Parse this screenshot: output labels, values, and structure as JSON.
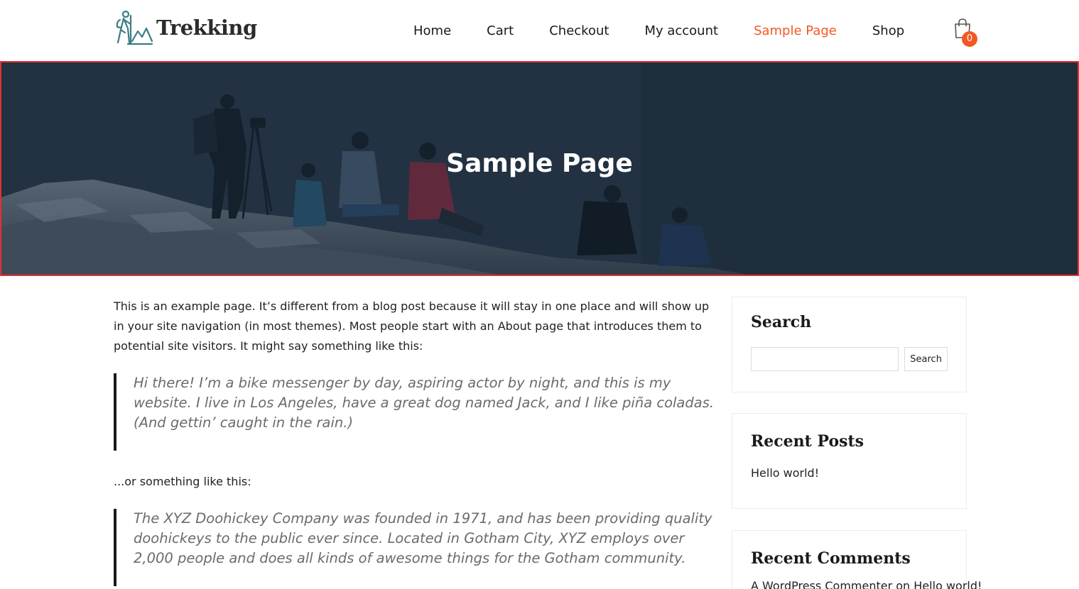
{
  "brand": {
    "name": "Trekking",
    "accent": "#f25822"
  },
  "nav": {
    "items": [
      {
        "label": "Home"
      },
      {
        "label": "Cart"
      },
      {
        "label": "Checkout"
      },
      {
        "label": "My account"
      },
      {
        "label": "Sample Page",
        "active": true
      },
      {
        "label": "Shop"
      }
    ]
  },
  "cart": {
    "icon": "shopping-bag-icon",
    "count": "0"
  },
  "hero": {
    "title": "Sample Page"
  },
  "content": {
    "intro": "This is an example page. It’s different from a blog post because it will stay in one place and will show up in your site navigation (in most themes). Most people start with an About page that introduces them to potential site visitors. It might say something like this:",
    "quote1": "Hi there! I’m a bike messenger by day, aspiring actor by night, and this is my website. I live in Los Angeles, have a great dog named Jack, and I like piña coladas. (And gettin’ caught in the rain.)",
    "transition": "...or something like this:",
    "quote2": "The XYZ Doohickey Company was founded in 1971, and has been providing quality doohickeys to the public ever since. Located in Gotham City, XYZ employs over 2,000 people and does all kinds of awesome things for the Gotham community."
  },
  "sidebar": {
    "search": {
      "title": "Search",
      "button_label": "Search",
      "value": ""
    },
    "recent_posts": {
      "title": "Recent Posts",
      "items": [
        "Hello world!"
      ]
    },
    "recent_comments": {
      "title": "Recent Comments",
      "author": "A WordPress Commenter",
      "on": "on",
      "post": "Hello world!"
    }
  }
}
